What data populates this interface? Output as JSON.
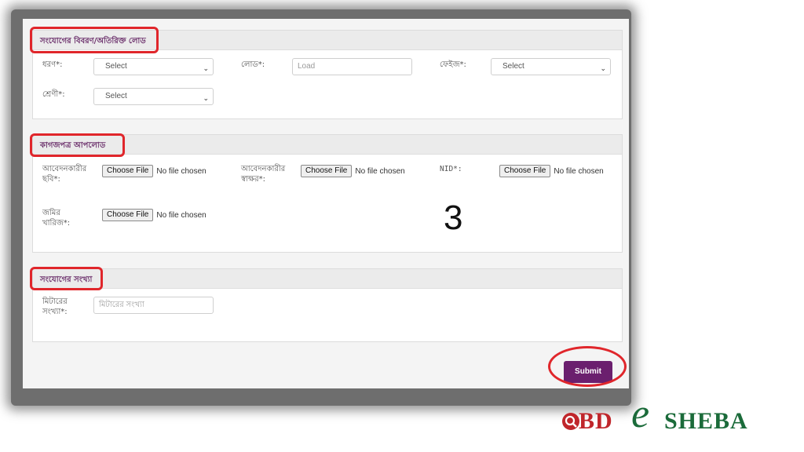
{
  "sections": {
    "details": {
      "title": "সংযোগের বিবরণ/অতিরিক্ত লোড",
      "type_label": "ধরণ*:",
      "type_value": "Select",
      "load_label": "লোড*:",
      "load_placeholder": "Load",
      "phase_label": "ফেইজ*:",
      "phase_value": "Select",
      "category_label": "শ্রেণী*:",
      "category_value": "Select"
    },
    "documents": {
      "title": "কাগজপত্র আপলোড",
      "photo_label": "আবেদনকারীর\nছবি*:",
      "signature_label": "আবেদনকারীর\nস্বাক্ষর*:",
      "nid_label": "NID*:",
      "land_label": "জমির\nখারিজ*:",
      "choose_file": "Choose File",
      "no_file": "No file chosen"
    },
    "connections": {
      "title": "সংযোগের সংখ্যা",
      "meter_label": "মিটারের\nসংখ্যা*:",
      "meter_placeholder": "মিটারের সংখ্যা"
    }
  },
  "submit_label": "Submit",
  "step_number": "3",
  "logo": {
    "bd": "BD",
    "e": "e",
    "sheba": "SHEBA"
  },
  "colors": {
    "highlight": "#e0262b",
    "section_title": "#6b2f6b",
    "submit_bg": "#6b1f6e"
  }
}
